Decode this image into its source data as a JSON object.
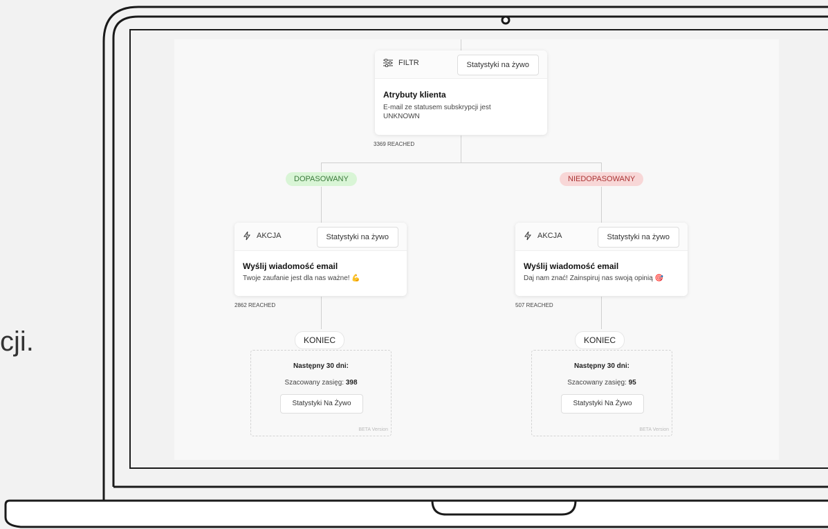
{
  "side_text": "cji.",
  "filter_card": {
    "kind": "FILTR",
    "stats_button": "Statystyki na żywo",
    "title": "Atrybuty klienta",
    "description": "E-mail ze statusem subskrypcji jest UNKNOWN",
    "reached": "3369 REACHED"
  },
  "branches": {
    "left": {
      "label": "DOPASOWANY",
      "action": {
        "kind": "AKCJA",
        "stats_button": "Statystyki na żywo",
        "title": "Wyślij wiadomość email",
        "description": "Twoje zaufanie jest dla nas ważne! 💪",
        "reached": "2862 REACHED"
      },
      "end_label": "KONIEC",
      "estimate": {
        "title": "Następny 30 dni:",
        "reach_label": "Szacowany zasięg:",
        "reach_value": "398",
        "button": "Statystyki Na Żywo",
        "beta": "BETA Version"
      }
    },
    "right": {
      "label": "NIEDOPASOWANY",
      "action": {
        "kind": "AKCJA",
        "stats_button": "Statystyki na żywo",
        "title": "Wyślij wiadomość email",
        "description": "Daj nam znać! Zainspiruj nas swoją opinią 🎯",
        "reached": "507 REACHED"
      },
      "end_label": "KONIEC",
      "estimate": {
        "title": "Następny 30 dni:",
        "reach_label": "Szacowany zasięg:",
        "reach_value": "95",
        "button": "Statystyki Na Żywo",
        "beta": "BETA Version"
      }
    }
  }
}
